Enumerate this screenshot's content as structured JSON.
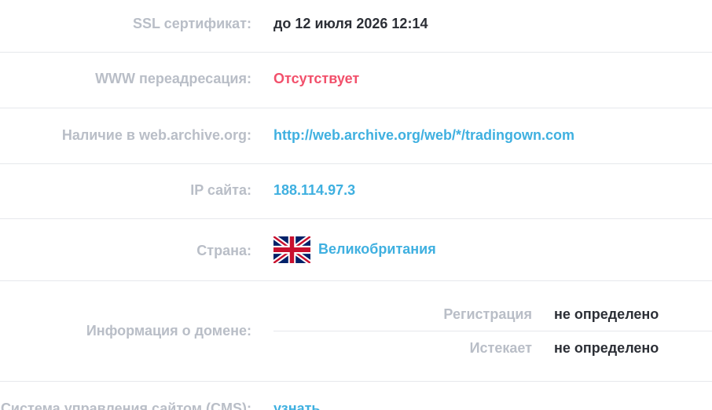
{
  "rows": [
    {
      "label": "SSL сертификат:",
      "value": "до 12 июля 2026 12:14"
    },
    {
      "label": "WWW переадресация:",
      "value": "Отсутствует"
    },
    {
      "label": "Наличие в web.archive.org:",
      "value": "http://web.archive.org/web/*/tradingown.com"
    },
    {
      "label": "IP сайта:",
      "value": "188.114.97.3"
    },
    {
      "label": "Страна:",
      "value": "Великобритания",
      "flag_icon": "uk-flag-icon"
    },
    {
      "label": "Информация о домене:",
      "sub_rows": [
        {
          "label": "Регистрация",
          "value": "не определено"
        },
        {
          "label": "Истекает",
          "value": "не определено"
        }
      ]
    },
    {
      "label": "Система управления сайтом (CMS):",
      "value": "узнать"
    }
  ],
  "colors": {
    "label": "#b9bec7",
    "value_dark": "#2c2f36",
    "value_red": "#f2506b",
    "link_blue": "#3fb0e0",
    "divider": "#e6e8ec"
  }
}
